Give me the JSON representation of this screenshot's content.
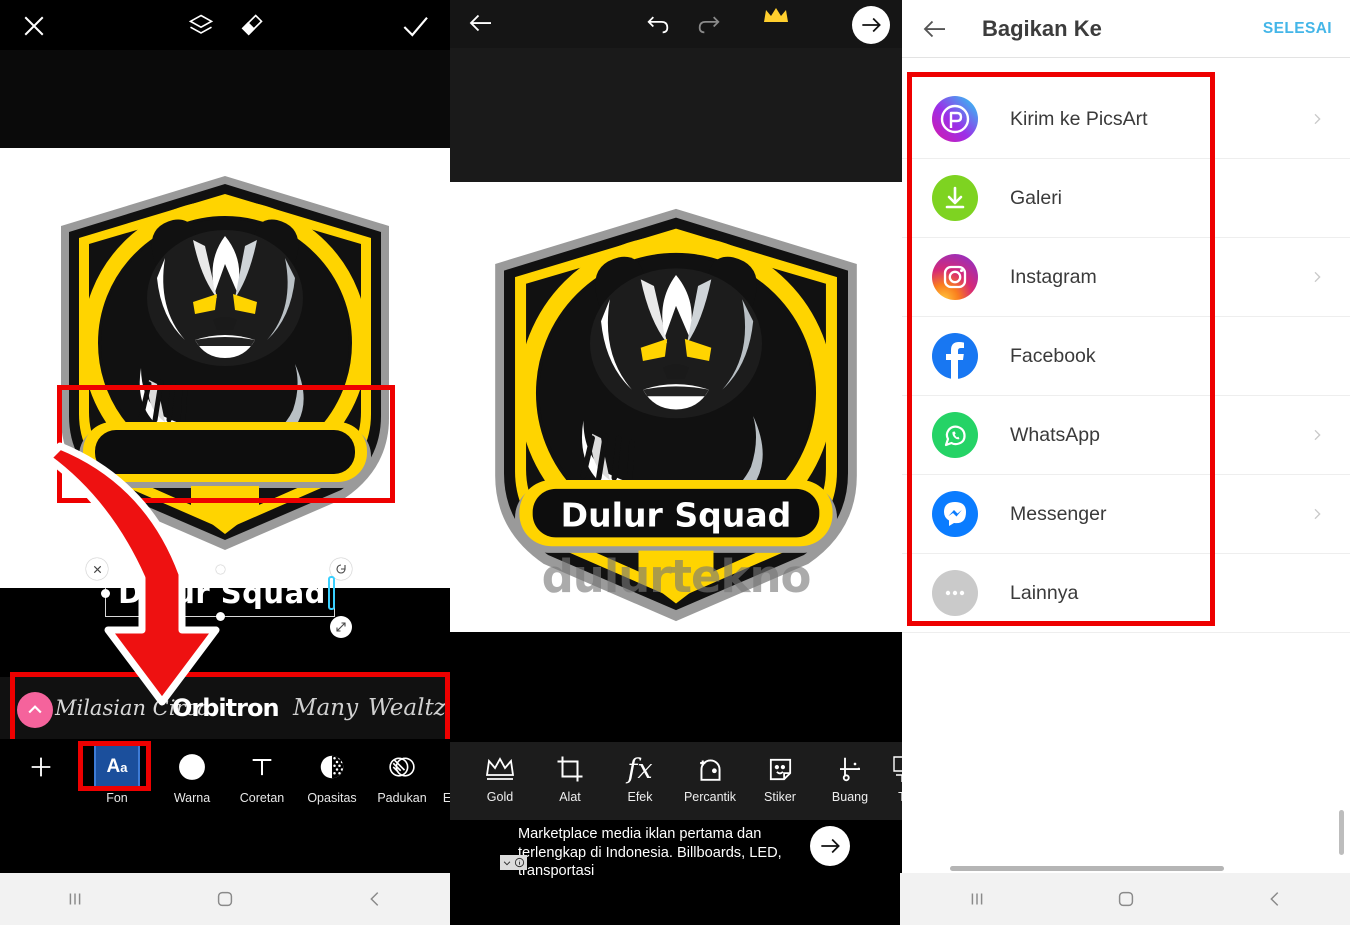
{
  "panel1": {
    "topbar": {
      "close": "✕",
      "layers_icon": "layers-icon",
      "eraser_icon": "eraser-icon",
      "confirm": "✓"
    },
    "text_object": {
      "value": "Dulur Squad",
      "delete_handle": "✕",
      "rotate_handle": "⟳",
      "resize_handle": "⤡"
    },
    "font_bar": {
      "collapse_label": "⌃",
      "fonts": [
        {
          "name": "Milasian Circa"
        },
        {
          "name": "Orbitron",
          "selected": true
        },
        {
          "name": "Many"
        },
        {
          "name": "Wealtz"
        }
      ]
    },
    "toolbar": [
      {
        "label": "",
        "icon": "plus-icon"
      },
      {
        "label": "Fon",
        "icon": "font-icon",
        "selected": true
      },
      {
        "label": "Warna",
        "icon": "color-circle-icon"
      },
      {
        "label": "Coretan",
        "icon": "stroke-t-icon"
      },
      {
        "label": "Opasitas",
        "icon": "opacity-icon"
      },
      {
        "label": "Padukan",
        "icon": "blend-icon"
      },
      {
        "label": "E",
        "icon": "effects-icon"
      }
    ]
  },
  "panel2": {
    "topbar": {
      "back": "←",
      "undo": "undo-icon",
      "redo": "redo-icon",
      "premium": "crown-icon",
      "next": "→"
    },
    "watermark": "dulurtekno",
    "logo_banner_text": "Dulur Squad",
    "toolbar": [
      {
        "label": "Gold",
        "icon": "crown-icon"
      },
      {
        "label": "Alat",
        "icon": "crop-tool-icon"
      },
      {
        "label": "Efek",
        "icon": "fx-icon"
      },
      {
        "label": "Percantik",
        "icon": "beautify-face-icon"
      },
      {
        "label": "Stiker",
        "icon": "sticker-icon"
      },
      {
        "label": "Buang",
        "icon": "remove-icon"
      },
      {
        "label": "T",
        "icon": "text-icon"
      }
    ],
    "ad": {
      "text": "Marketplace media iklan pertama dan terlengkap di Indonesia. Billboards, LED, transportasi",
      "cta": "→",
      "badge": "⌄ ⓘ"
    }
  },
  "panel3": {
    "header": {
      "back": "←",
      "title": "Bagikan Ke",
      "done": "SELESAI"
    },
    "share_items": [
      {
        "label": "Kirim ke PicsArt",
        "icon": "picsart-icon",
        "chevron": true
      },
      {
        "label": "Galeri",
        "icon": "download-icon",
        "chevron": false
      },
      {
        "label": "Instagram",
        "icon": "instagram-icon",
        "chevron": true
      },
      {
        "label": "Facebook",
        "icon": "facebook-icon",
        "chevron": false
      },
      {
        "label": "WhatsApp",
        "icon": "whatsapp-icon",
        "chevron": true
      },
      {
        "label": "Messenger",
        "icon": "messenger-icon",
        "chevron": true
      },
      {
        "label": "Lainnya",
        "icon": "more-dots-icon",
        "chevron": false
      }
    ]
  },
  "android_nav": {
    "recents": "recents-icon",
    "home": "home-icon",
    "back": "back-icon"
  },
  "annotations": {
    "highlight_color": "#ee0000",
    "arrow_color": "#ee1111"
  },
  "colors": {
    "accent_done": "#44b6e8",
    "pink_button": "#f5639c",
    "selected_font_tool": "#1b4f9c",
    "logo_yellow": "#ffd400"
  }
}
